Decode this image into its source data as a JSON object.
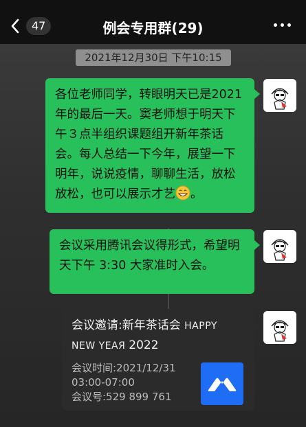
{
  "header": {
    "back_count": "47",
    "title": "例会专用群(29)"
  },
  "chat": {
    "timestamp": "2021年12月30日 下午10:15",
    "messages": [
      {
        "text": "各位老师同学，转眼明天已是2021年的最后一天。窦老师想于明天下午３点半组织课题组开新年茶话会。每人总结一下今年，展望一下明年，说说疫情，聊聊生活，放松放松，也可以展示才艺",
        "suffix": "。"
      },
      {
        "text": "会议采用腾讯会议得形式，希望明天下午 3:30 大家准时入会。"
      }
    ],
    "meeting_card": {
      "title_prefix": "会议邀请:新年茶话会 ",
      "title_happy": "HAPPY",
      "title_new_year": "NEW YEAЯ ",
      "title_year": "2022",
      "time_label": "会议时间:2021/12/31",
      "time_range": "03:00-07:00",
      "meeting_id": "会议号:529 899 761"
    }
  },
  "colors": {
    "bubble": "#28c05b",
    "meeting_logo": "#1f6cf5"
  },
  "icons": {
    "back": "chevron-left-icon",
    "more": "more-dots-icon",
    "emoji": "grinning-face-icon",
    "meeting_logo": "tencent-meeting-icon"
  }
}
